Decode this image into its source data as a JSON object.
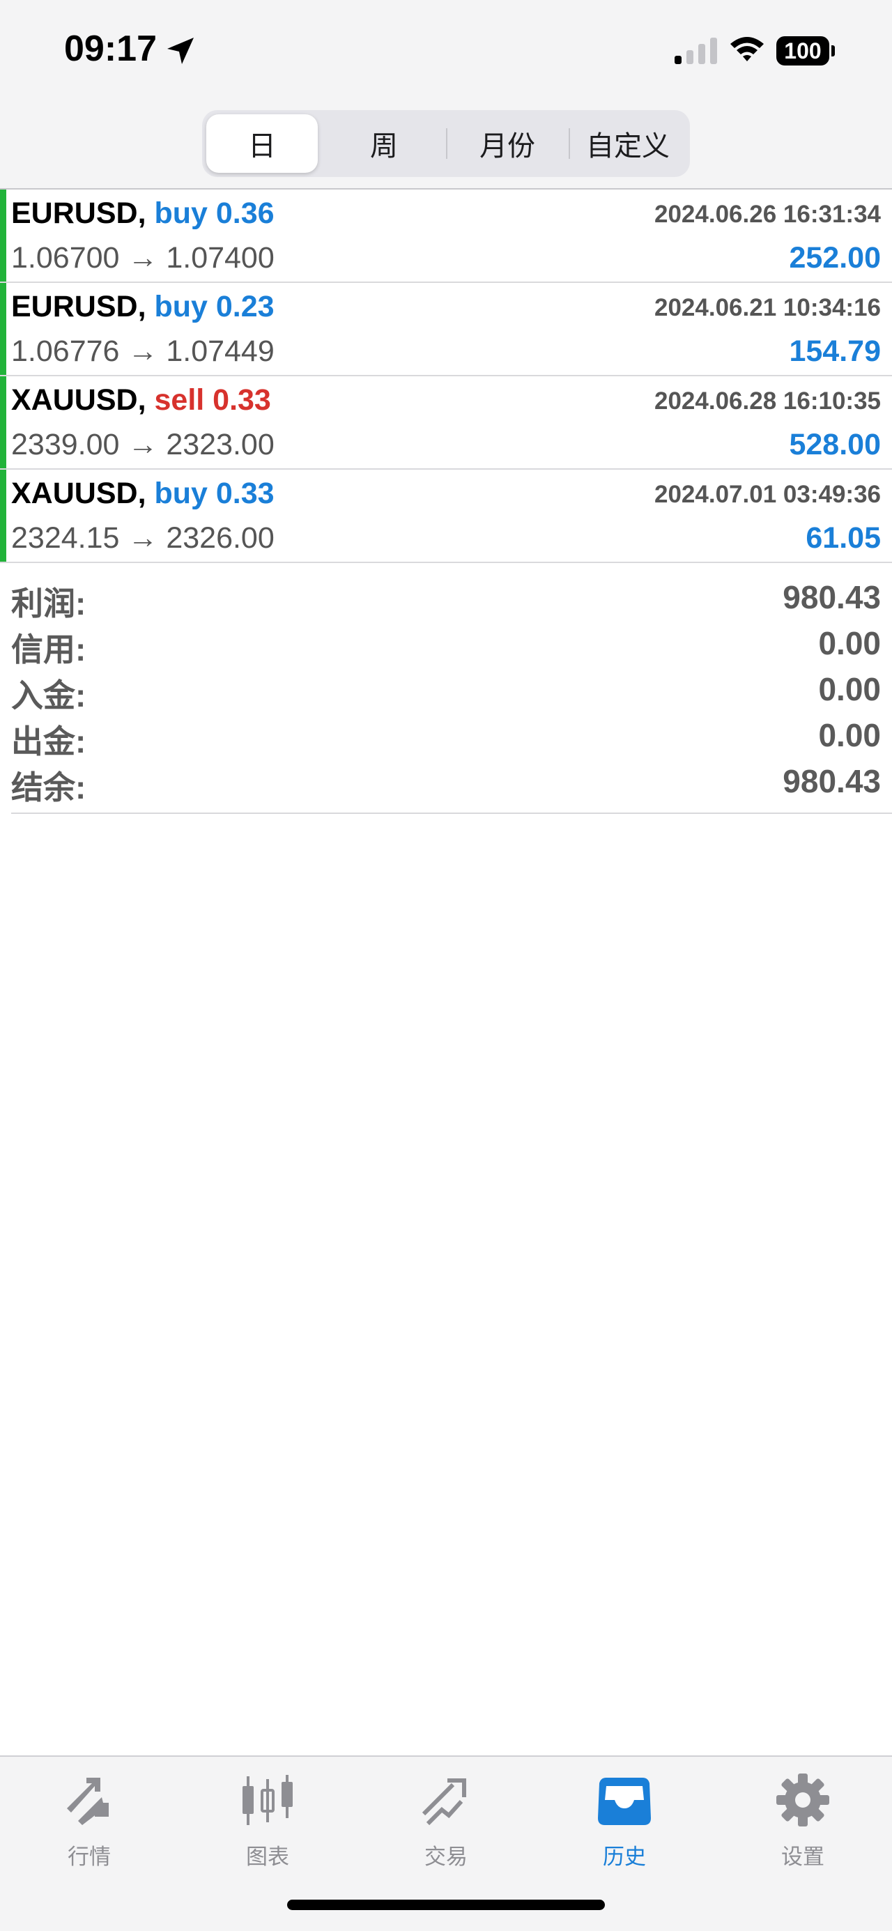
{
  "status_bar": {
    "time": "09:17",
    "battery": "100"
  },
  "period_tabs": [
    "日",
    "周",
    "月份",
    "自定义"
  ],
  "active_period": "日",
  "trades": [
    {
      "symbol": "EURUSD,",
      "side": "buy 0.36",
      "type": "buy",
      "time": "2024.06.26 16:31:34",
      "prices": "1.06700 → 1.07400",
      "profit": "252.00"
    },
    {
      "symbol": "EURUSD,",
      "side": "buy 0.23",
      "type": "buy",
      "time": "2024.06.21 10:34:16",
      "prices": "1.06776 → 1.07449",
      "profit": "154.79"
    },
    {
      "symbol": "XAUUSD,",
      "side": "sell 0.33",
      "type": "sell",
      "time": "2024.06.28 16:10:35",
      "prices": "2339.00 → 2323.00",
      "profit": "528.00"
    },
    {
      "symbol": "XAUUSD,",
      "side": "buy 0.33",
      "type": "buy",
      "time": "2024.07.01 03:49:36",
      "prices": "2324.15 → 2326.00",
      "profit": "61.05"
    }
  ],
  "summary": [
    {
      "label": "利润:",
      "value": "980.43"
    },
    {
      "label": "信用:",
      "value": "0.00"
    },
    {
      "label": "入金:",
      "value": "0.00"
    },
    {
      "label": "出金:",
      "value": "0.00"
    },
    {
      "label": "结余:",
      "value": "980.43"
    }
  ],
  "tabbar": [
    {
      "label": "行情",
      "icon": "quotes-icon"
    },
    {
      "label": "图表",
      "icon": "chart-icon"
    },
    {
      "label": "交易",
      "icon": "trade-icon"
    },
    {
      "label": "历史",
      "icon": "history-icon"
    },
    {
      "label": "设置",
      "icon": "settings-icon"
    }
  ],
  "active_tab": "历史",
  "colors": {
    "accent": "#1a7fd8",
    "sell": "#d7322d",
    "trade_bar": "#22b33a",
    "inactive": "#8e8e93"
  }
}
